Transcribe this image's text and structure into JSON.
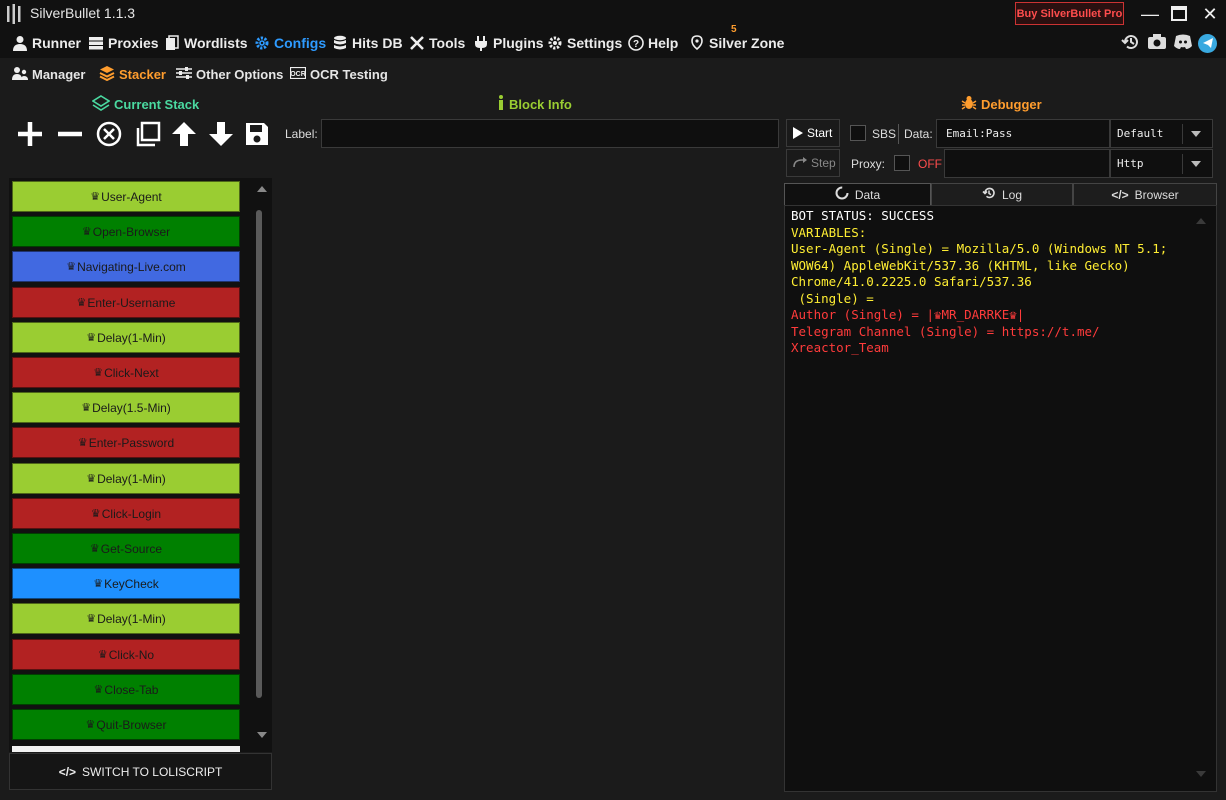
{
  "window": {
    "title": "SilverBullet 1.1.3",
    "buy_label": "Buy SilverBullet Pro",
    "minimize_icon": "minimize-icon",
    "maximize_icon": "maximize-icon",
    "close_icon": "close-icon"
  },
  "nav": {
    "items": [
      {
        "label": "Runner",
        "icon": "user-icon"
      },
      {
        "label": "Proxies",
        "icon": "server-icon"
      },
      {
        "label": "Wordlists",
        "icon": "files-icon"
      },
      {
        "label": "Configs",
        "icon": "gear-icon"
      },
      {
        "label": "Hits DB",
        "icon": "database-icon"
      },
      {
        "label": "Tools",
        "icon": "tools-icon"
      },
      {
        "label": "Plugins",
        "icon": "plug-icon"
      },
      {
        "label": "Settings",
        "icon": "settings-icon"
      },
      {
        "label": "Help",
        "icon": "help-icon"
      },
      {
        "label": "Silver Zone",
        "icon": "location-icon"
      }
    ],
    "active": "Configs",
    "silver_zone_badge": "5",
    "right_icons": [
      "history-icon",
      "camera-icon",
      "discord-icon",
      "telegram-icon"
    ]
  },
  "subnav": {
    "items": [
      {
        "label": "Manager",
        "icon": "users-icon"
      },
      {
        "label": "Stacker",
        "icon": "layers-icon"
      },
      {
        "label": "Other Options",
        "icon": "sliders-icon"
      },
      {
        "label": "OCR Testing",
        "icon": "ocr-icon"
      }
    ],
    "active": "Stacker"
  },
  "stacker": {
    "current_stack_title": "Current Stack",
    "block_info_title": "Block Info",
    "label_text": "Label:",
    "label_value": "",
    "switch_label": "SWITCH TO LOLISCRIPT",
    "blocks": [
      {
        "label": "User-Agent",
        "color": "#9acd32",
        "text_color": "#1a1a1a"
      },
      {
        "label": "Open-Browser",
        "color": "#008000",
        "text_color": "#1a1a1a"
      },
      {
        "label": "Navigating-Live.com",
        "color": "#4169e1",
        "text_color": "#1a1a1a"
      },
      {
        "label": "Enter-Username",
        "color": "#b22222",
        "text_color": "#1a1a1a"
      },
      {
        "label": "Delay(1-Min)",
        "color": "#9acd32",
        "text_color": "#1a1a1a"
      },
      {
        "label": "Click-Next",
        "color": "#b22222",
        "text_color": "#1a1a1a"
      },
      {
        "label": "Delay(1.5-Min)",
        "color": "#9acd32",
        "text_color": "#1a1a1a"
      },
      {
        "label": "Enter-Password",
        "color": "#b22222",
        "text_color": "#1a1a1a"
      },
      {
        "label": "Delay(1-Min)",
        "color": "#9acd32",
        "text_color": "#1a1a1a"
      },
      {
        "label": "Click-Login",
        "color": "#b22222",
        "text_color": "#1a1a1a"
      },
      {
        "label": "Get-Source",
        "color": "#008000",
        "text_color": "#1a1a1a"
      },
      {
        "label": "KeyCheck",
        "color": "#1e90ff",
        "text_color": "#1a1a1a"
      },
      {
        "label": "Delay(1-Min)",
        "color": "#9acd32",
        "text_color": "#1a1a1a"
      },
      {
        "label": "Click-No",
        "color": "#b22222",
        "text_color": "#1a1a1a"
      },
      {
        "label": "Close-Tab",
        "color": "#008000",
        "text_color": "#1a1a1a"
      },
      {
        "label": "Quit-Browser",
        "color": "#008000",
        "text_color": "#1a1a1a"
      }
    ]
  },
  "debugger": {
    "title": "Debugger",
    "start_label": "Start",
    "step_label": "Step",
    "sbs_label": "SBS",
    "data_label": "Data:",
    "data_value": "Email:Pass",
    "type_value": "Default",
    "proxy_label": "Proxy:",
    "proxy_state": "OFF",
    "proxy_value": "",
    "proxy_type_value": "Http",
    "tabs": [
      "Data",
      "Log",
      "Browser"
    ],
    "active_tab": "Data",
    "output": {
      "status": "BOT STATUS: SUCCESS",
      "variables_header": "VARIABLES:",
      "user_agent": "User-Agent (Single) = Mozilla/5.0 (Windows NT 5.1; WOW64) AppleWebKit/537.36 (KHTML, like Gecko) Chrome/41.0.2225.0 Safari/537.36",
      "empty_single": " (Single) =",
      "author_prefix": "Author (Single) = |",
      "author_name": "MR_DARRKE",
      "author_suffix": "|",
      "telegram": "Telegram Channel (Single) = https://t.me/ Xreactor_Team"
    }
  },
  "colors": {
    "accent_blue": "#2e9bff",
    "accent_orange": "#ff9d2e",
    "current_stack_green": "#4ad9a0",
    "block_info_green": "#9acd32",
    "yellow_text": "#ffee33",
    "red_text": "#ff3b3b"
  }
}
